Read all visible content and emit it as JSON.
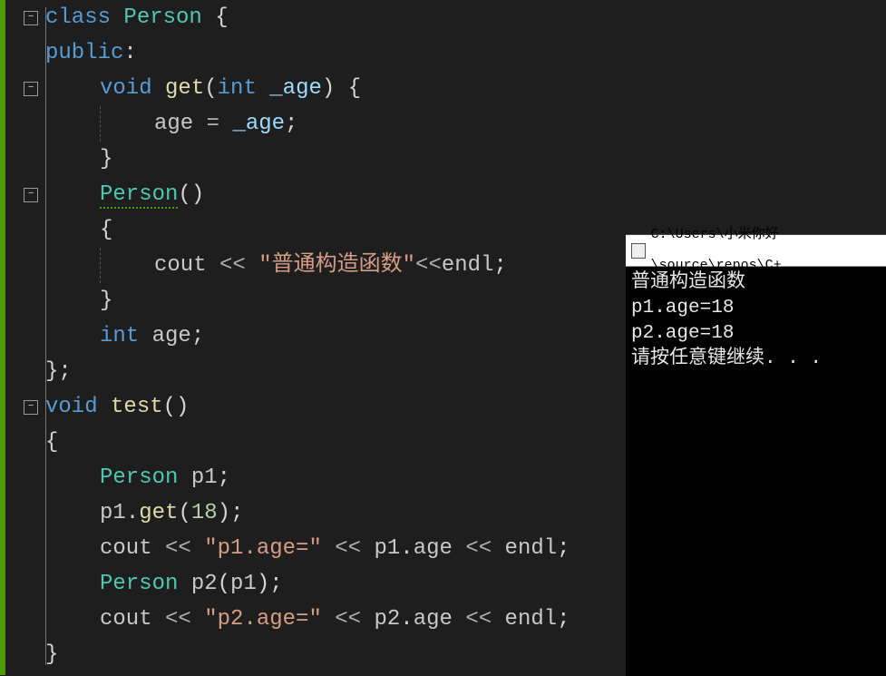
{
  "editor": {
    "lines": [
      {
        "indent": 0,
        "fold": true,
        "tokens": [
          [
            "kw",
            "class"
          ],
          [
            "sp",
            " "
          ],
          [
            "type",
            "Person"
          ],
          [
            "sp",
            " "
          ],
          [
            "punc",
            "{"
          ]
        ]
      },
      {
        "indent": 0,
        "fold": false,
        "tokens": [
          [
            "kw",
            "public"
          ],
          [
            "punc",
            ":"
          ]
        ]
      },
      {
        "indent": 1,
        "fold": true,
        "tokens": [
          [
            "kw",
            "void"
          ],
          [
            "sp",
            " "
          ],
          [
            "func",
            "get"
          ],
          [
            "punc",
            "("
          ],
          [
            "kw",
            "int"
          ],
          [
            "sp",
            " "
          ],
          [
            "param",
            "_age"
          ],
          [
            "punc",
            ")"
          ],
          [
            "sp",
            " "
          ],
          [
            "punc",
            "{"
          ]
        ]
      },
      {
        "indent": 2,
        "fold": false,
        "tokens": [
          [
            "var",
            "age"
          ],
          [
            "sp",
            " "
          ],
          [
            "op",
            "="
          ],
          [
            "sp",
            " "
          ],
          [
            "param",
            "_age"
          ],
          [
            "punc",
            ";"
          ]
        ]
      },
      {
        "indent": 1,
        "fold": false,
        "tokens": [
          [
            "punc",
            "}"
          ]
        ]
      },
      {
        "indent": 1,
        "fold": true,
        "tokens": [
          [
            "type squiggle",
            "Person"
          ],
          [
            "punc",
            "()"
          ]
        ]
      },
      {
        "indent": 1,
        "fold": false,
        "tokens": [
          [
            "punc",
            "{"
          ]
        ]
      },
      {
        "indent": 2,
        "fold": false,
        "tokens": [
          [
            "var",
            "cout"
          ],
          [
            "sp",
            " "
          ],
          [
            "op",
            "<<"
          ],
          [
            "sp",
            " "
          ],
          [
            "str",
            "\"普通构造函数\""
          ],
          [
            "op",
            "<<"
          ],
          [
            "var",
            "endl"
          ],
          [
            "punc",
            ";"
          ]
        ]
      },
      {
        "indent": 1,
        "fold": false,
        "current": true,
        "tokens": [
          [
            "punc",
            "}"
          ]
        ]
      },
      {
        "indent": 1,
        "fold": false,
        "tokens": [
          [
            "kw",
            "int"
          ],
          [
            "sp",
            " "
          ],
          [
            "var",
            "age"
          ],
          [
            "punc",
            ";"
          ]
        ]
      },
      {
        "indent": 0,
        "fold": false,
        "tokens": [
          [
            "punc",
            "};"
          ]
        ]
      },
      {
        "indent": 0,
        "fold": true,
        "tokens": [
          [
            "kw",
            "void"
          ],
          [
            "sp",
            " "
          ],
          [
            "func",
            "test"
          ],
          [
            "punc",
            "()"
          ]
        ]
      },
      {
        "indent": 0,
        "fold": false,
        "tokens": [
          [
            "punc",
            "{"
          ]
        ]
      },
      {
        "indent": 1,
        "fold": false,
        "tokens": [
          [
            "type",
            "Person"
          ],
          [
            "sp",
            " "
          ],
          [
            "var",
            "p1"
          ],
          [
            "punc",
            ";"
          ]
        ]
      },
      {
        "indent": 1,
        "fold": false,
        "tokens": [
          [
            "var",
            "p1"
          ],
          [
            "punc",
            "."
          ],
          [
            "func",
            "get"
          ],
          [
            "punc",
            "("
          ],
          [
            "num",
            "18"
          ],
          [
            "punc",
            ")"
          ],
          [
            "punc",
            ";"
          ]
        ]
      },
      {
        "indent": 1,
        "fold": false,
        "tokens": [
          [
            "var",
            "cout"
          ],
          [
            "sp",
            " "
          ],
          [
            "op",
            "<<"
          ],
          [
            "sp",
            " "
          ],
          [
            "str",
            "\"p1.age=\""
          ],
          [
            "sp",
            " "
          ],
          [
            "op",
            "<<"
          ],
          [
            "sp",
            " "
          ],
          [
            "var",
            "p1"
          ],
          [
            "punc",
            "."
          ],
          [
            "var",
            "age"
          ],
          [
            "sp",
            " "
          ],
          [
            "op",
            "<<"
          ],
          [
            "sp",
            " "
          ],
          [
            "var",
            "endl"
          ],
          [
            "punc",
            ";"
          ]
        ]
      },
      {
        "indent": 1,
        "fold": false,
        "tokens": [
          [
            "type",
            "Person"
          ],
          [
            "sp",
            " "
          ],
          [
            "var",
            "p2"
          ],
          [
            "punc",
            "("
          ],
          [
            "var",
            "p1"
          ],
          [
            "punc",
            ")"
          ],
          [
            "punc",
            ";"
          ]
        ]
      },
      {
        "indent": 1,
        "fold": false,
        "tokens": [
          [
            "var",
            "cout"
          ],
          [
            "sp",
            " "
          ],
          [
            "op",
            "<<"
          ],
          [
            "sp",
            " "
          ],
          [
            "str",
            "\"p2.age=\""
          ],
          [
            "sp",
            " "
          ],
          [
            "op",
            "<<"
          ],
          [
            "sp",
            " "
          ],
          [
            "var",
            "p2"
          ],
          [
            "punc",
            "."
          ],
          [
            "var",
            "age"
          ],
          [
            "sp",
            " "
          ],
          [
            "op",
            "<<"
          ],
          [
            "sp",
            " "
          ],
          [
            "var",
            "endl"
          ],
          [
            "punc",
            ";"
          ]
        ]
      },
      {
        "indent": 0,
        "fold": false,
        "tokens": [
          [
            "punc",
            "}"
          ]
        ]
      }
    ],
    "fold_glyph": "−"
  },
  "console": {
    "title": "C:\\Users\\小米你好\\source\\repos\\C+",
    "output": [
      "普通构造函数",
      "p1.age=18",
      "p2.age=18",
      "请按任意键继续. . ."
    ]
  }
}
